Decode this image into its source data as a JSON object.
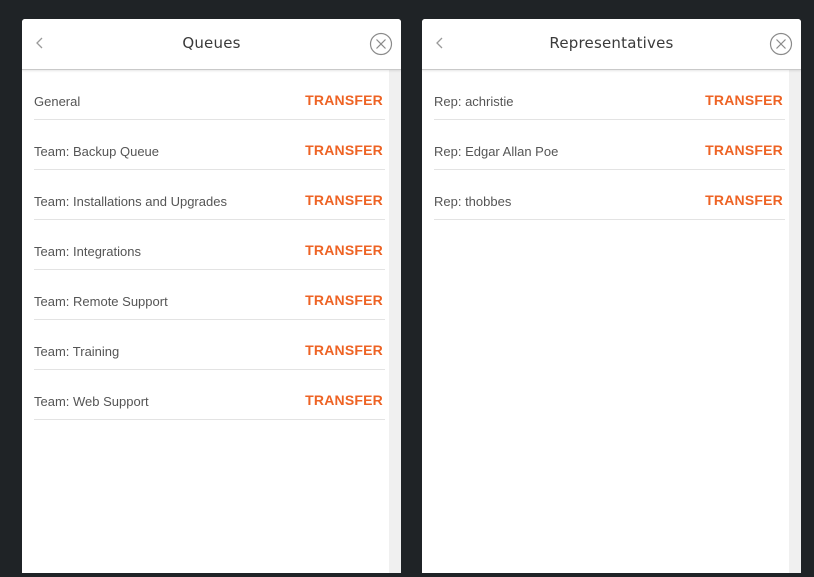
{
  "colors": {
    "accent": "#ee6324",
    "background": "#1f2326",
    "panel": "#ffffff"
  },
  "panels": [
    {
      "title": "Queues",
      "back_icon": "chevron-left-icon",
      "close_icon": "close-circle-icon",
      "items": [
        {
          "label": "General",
          "action": "TRANSFER"
        },
        {
          "label": "Team: Backup Queue",
          "action": "TRANSFER"
        },
        {
          "label": "Team: Installations and Upgrades",
          "action": "TRANSFER"
        },
        {
          "label": "Team: Integrations",
          "action": "TRANSFER"
        },
        {
          "label": "Team: Remote Support",
          "action": "TRANSFER"
        },
        {
          "label": "Team: Training",
          "action": "TRANSFER"
        },
        {
          "label": "Team: Web Support",
          "action": "TRANSFER"
        }
      ]
    },
    {
      "title": "Representatives",
      "back_icon": "chevron-left-icon",
      "close_icon": "close-circle-icon",
      "items": [
        {
          "label": "Rep: achristie",
          "action": "TRANSFER"
        },
        {
          "label": "Rep: Edgar Allan Poe",
          "action": "TRANSFER"
        },
        {
          "label": "Rep: thobbes",
          "action": "TRANSFER"
        }
      ]
    }
  ]
}
